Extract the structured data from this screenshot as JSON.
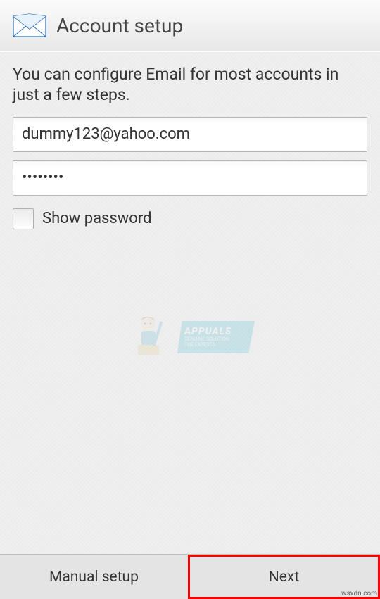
{
  "header": {
    "title": "Account setup"
  },
  "content": {
    "intro": "You can configure Email for most accounts in just a few steps.",
    "email_value": "dummy123@yahoo.com",
    "password_value": "••••••••",
    "show_password_label": "Show password"
  },
  "watermark": {
    "brand": "APPUALS",
    "tagline1": "GENUINE SOLUTION",
    "tagline2": "THE EXPERTS"
  },
  "footer": {
    "manual_label": "Manual setup",
    "next_label": "Next",
    "credit": "wsxdn.com"
  }
}
